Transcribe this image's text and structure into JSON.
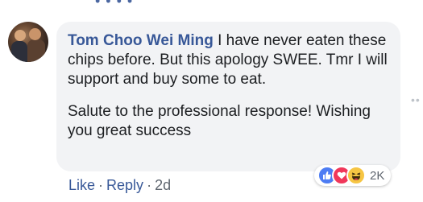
{
  "comment": {
    "author": "Tom Choo Wei Ming",
    "text_line1": " I have never eaten these chips before. But this apology SWEE. Tmr I will support and buy some to eat.",
    "text_para2": "Salute to the professional response! Wishing you great success"
  },
  "reactions": {
    "icons": [
      "like-icon",
      "love-icon",
      "haha-icon"
    ],
    "colors": {
      "like": "#4d7cf3",
      "love": "#f0375a",
      "haha": "#f6c543"
    },
    "count": "2K"
  },
  "actions": {
    "like_label": "Like",
    "reply_label": "Reply",
    "separator": "·",
    "timestamp": "2d"
  }
}
